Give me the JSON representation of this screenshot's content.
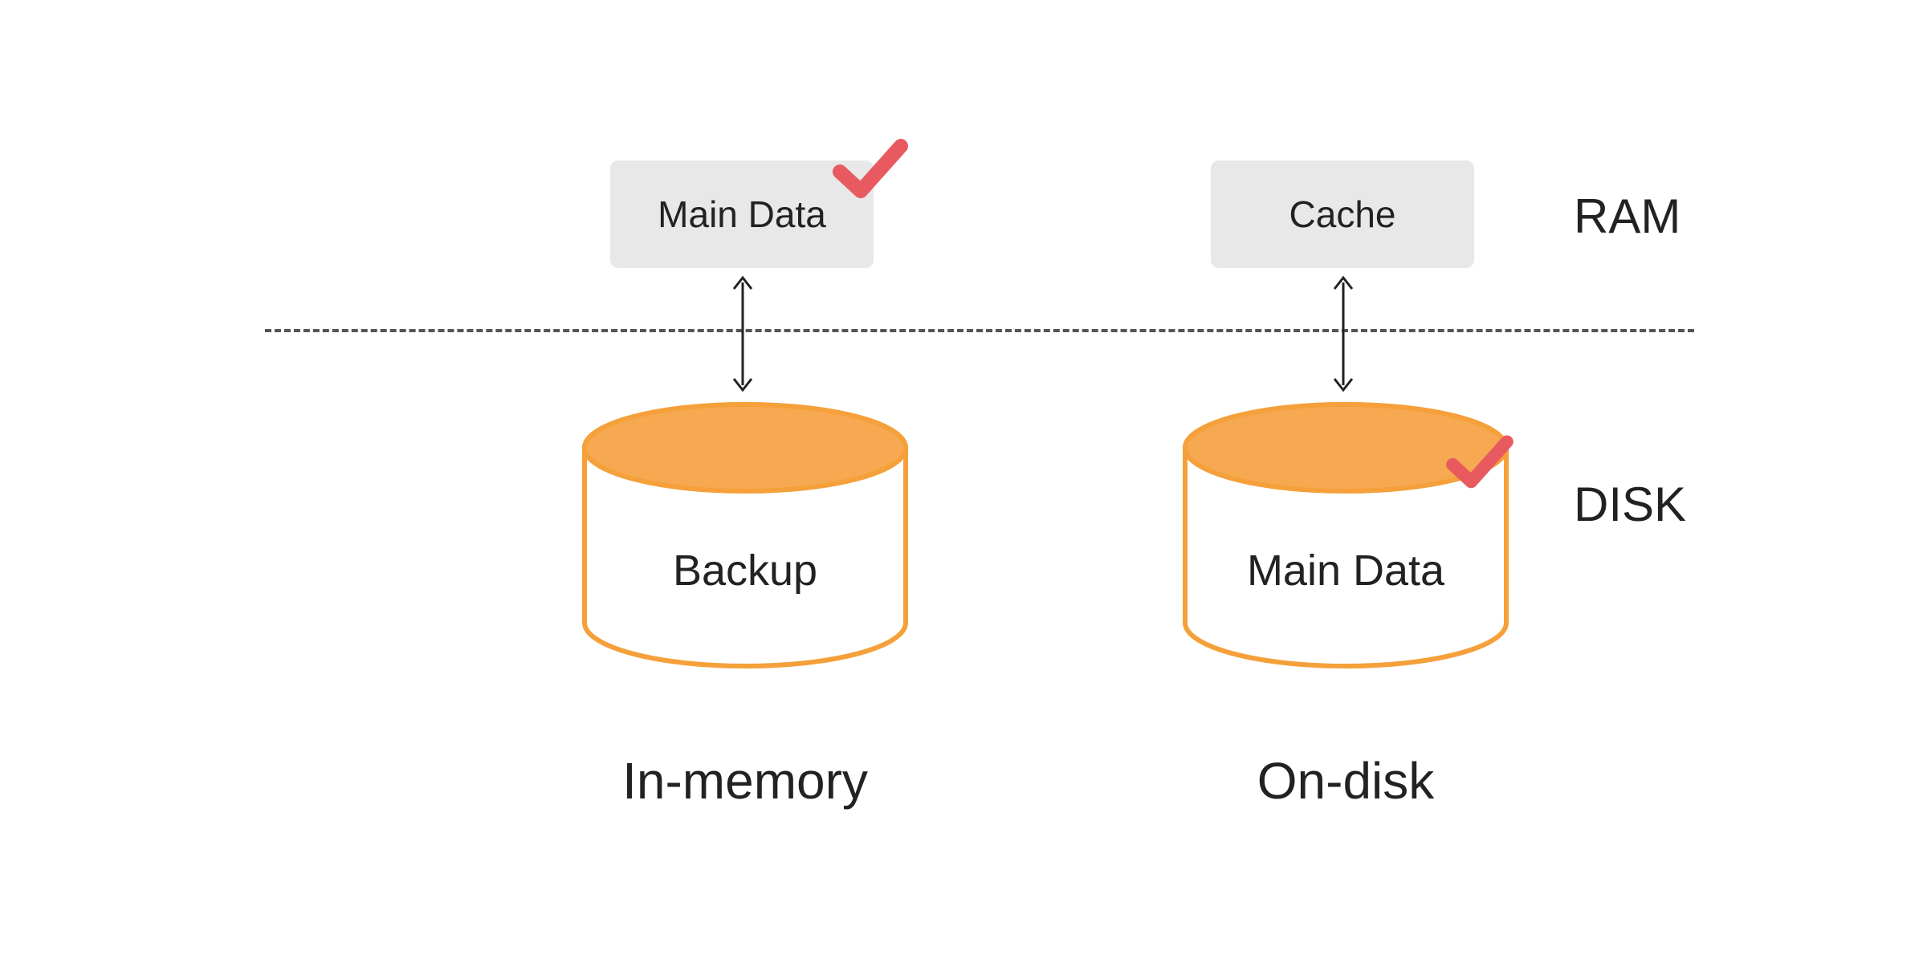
{
  "ram_label": "RAM",
  "disk_label": "DISK",
  "left": {
    "ram_box": "Main Data",
    "disk_cylinder": "Backup",
    "column_title": "In-memory",
    "ram_has_check": true,
    "disk_has_check": false
  },
  "right": {
    "ram_box": "Cache",
    "disk_cylinder": "Main Data",
    "column_title": "On-disk",
    "ram_has_check": false,
    "disk_has_check": true
  },
  "colors": {
    "box_bg": "#e8e8e8",
    "cylinder_stroke": "#f5a03a",
    "cylinder_top_fill": "#f6a951",
    "check": "#e85a5f",
    "text": "#222222",
    "divider": "#555555"
  }
}
